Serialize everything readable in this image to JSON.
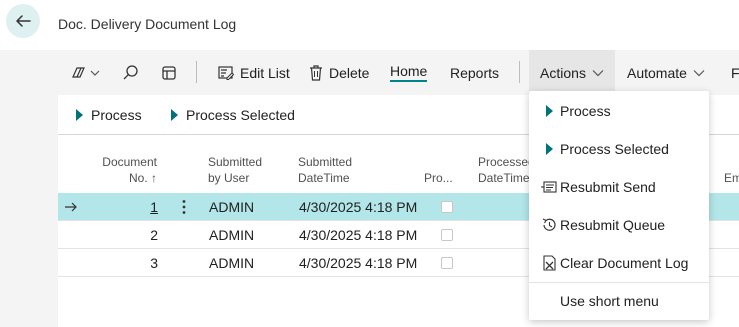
{
  "header": {
    "title": "Doc. Delivery Document Log"
  },
  "toolbar": {
    "edit_list": "Edit List",
    "delete": "Delete",
    "home": "Home",
    "reports": "Reports",
    "actions": "Actions",
    "automate": "Automate",
    "overflow_fragment": "Fe"
  },
  "action_bar": {
    "process": "Process",
    "process_selected": "Process Selected"
  },
  "columns": {
    "document_no_line1": "Document",
    "document_no_line2": "No. ↑",
    "submitted_by_line1": "Submitted",
    "submitted_by_line2": "by User",
    "submitted_dt_line1": "Submitted",
    "submitted_dt_line2": "DateTime",
    "processed_flag": "Pro...",
    "processed_dt_line1": "Processed",
    "processed_dt_line2": "DateTime",
    "em_fragment": "Em"
  },
  "rows": [
    {
      "no": "1",
      "user": "ADMIN",
      "datetime": "4/30/2025 4:18 PM",
      "processed": false
    },
    {
      "no": "2",
      "user": "ADMIN",
      "datetime": "4/30/2025 4:18 PM",
      "processed": false
    },
    {
      "no": "3",
      "user": "ADMIN",
      "datetime": "4/30/2025 4:18 PM",
      "processed": false
    }
  ],
  "actions_menu": {
    "items": [
      {
        "label": "Process",
        "icon": "play-icon"
      },
      {
        "label": "Process Selected",
        "icon": "play-icon"
      },
      {
        "label": "Resubmit Send",
        "icon": "send-icon"
      },
      {
        "label": "Resubmit Queue",
        "icon": "queue-icon"
      },
      {
        "label": "Clear Document Log",
        "icon": "clear-log-icon"
      }
    ],
    "short_menu": "Use short menu"
  },
  "colors": {
    "accent": "#008489",
    "selected_row": "#b2e6e8",
    "back_button_bg": "#dff0f0"
  }
}
